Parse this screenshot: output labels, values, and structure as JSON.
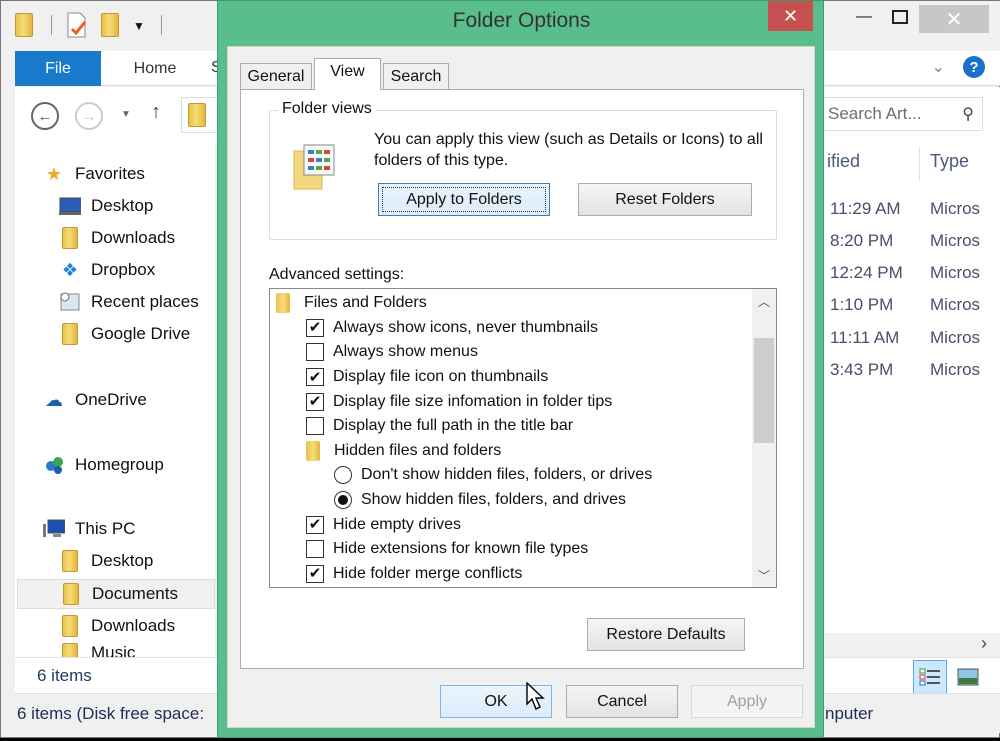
{
  "explorer": {
    "ribbon_tabs": {
      "file": "File",
      "home": "Home",
      "partial_tab": "S"
    },
    "search_placeholder": "Search Art...",
    "nav_pane": {
      "favorites": "Favorites",
      "favorites_items": [
        "Desktop",
        "Downloads",
        "Dropbox",
        "Recent places",
        "Google Drive"
      ],
      "onedrive": "OneDrive",
      "homegroup": "Homegroup",
      "this_pc": "This PC",
      "this_pc_items": [
        "Desktop",
        "Documents",
        "Downloads",
        "Music"
      ],
      "selected": "Documents"
    },
    "columns": {
      "modified_partial": "ified",
      "type": "Type"
    },
    "rows": [
      {
        "time": "11:29 AM",
        "type": "Micros"
      },
      {
        "time": "8:20 PM",
        "type": "Micros"
      },
      {
        "time": "12:24 PM",
        "type": "Micros"
      },
      {
        "time": "1:10 PM",
        "type": "Micros"
      },
      {
        "time": "11:11 AM",
        "type": "Micros"
      },
      {
        "time": "3:43 PM",
        "type": "Micros"
      }
    ],
    "item_count": "6 items",
    "statusbar_left": "6 items (Disk free space:",
    "statusbar_right": "nputer"
  },
  "dialog": {
    "title": "Folder Options",
    "tabs": [
      "General",
      "View",
      "Search"
    ],
    "active_tab": "View",
    "folder_views": {
      "legend": "Folder views",
      "description": "You can apply this view (such as Details or Icons) to all folders of this type.",
      "apply_button": "Apply to Folders",
      "reset_button": "Reset Folders"
    },
    "advanced_label": "Advanced settings:",
    "advanced_items": [
      {
        "type": "folder",
        "label": "Files and Folders",
        "level": 0
      },
      {
        "type": "checkbox",
        "label": "Always show icons, never thumbnails",
        "checked": true,
        "level": 1
      },
      {
        "type": "checkbox",
        "label": "Always show menus",
        "checked": false,
        "level": 1
      },
      {
        "type": "checkbox",
        "label": "Display file icon on thumbnails",
        "checked": true,
        "level": 1
      },
      {
        "type": "checkbox",
        "label": "Display file size infomation in folder tips",
        "checked": true,
        "level": 1
      },
      {
        "type": "checkbox",
        "label": "Display the full path in the title bar",
        "checked": false,
        "level": 1
      },
      {
        "type": "folder",
        "label": "Hidden files and folders",
        "level": 1
      },
      {
        "type": "radio",
        "label": "Don't show hidden files, folders, or drives",
        "checked": false,
        "level": 2
      },
      {
        "type": "radio",
        "label": "Show hidden files, folders, and drives",
        "checked": true,
        "level": 2
      },
      {
        "type": "checkbox",
        "label": "Hide empty drives",
        "checked": true,
        "level": 1
      },
      {
        "type": "checkbox",
        "label": "Hide extensions for known file types",
        "checked": false,
        "level": 1
      },
      {
        "type": "checkbox",
        "label": "Hide folder merge conflicts",
        "checked": true,
        "level": 1
      }
    ],
    "scroll_position": {
      "thumb_start_fraction": 0.1,
      "thumb_size_fraction": 0.42
    },
    "restore_defaults": "Restore Defaults",
    "ok": "OK",
    "cancel": "Cancel",
    "apply": "Apply"
  }
}
